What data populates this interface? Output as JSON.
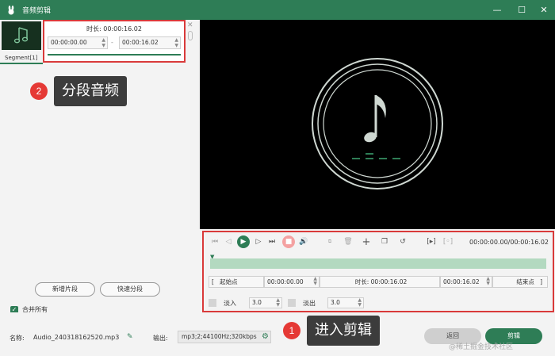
{
  "window": {
    "title": "音频剪辑",
    "logo_icon": "rabbit-icon"
  },
  "controls": {
    "min": "—",
    "max": "☐",
    "close": "✕"
  },
  "segment": {
    "label": "Segment[1]",
    "duration_label": "时长:",
    "duration": "00:00:16.02",
    "start": "00:00:00.00",
    "end": "00:00:16.02",
    "separator": "-"
  },
  "left_buttons": {
    "new_segment": "新增片段",
    "quick_split": "快速分段",
    "merge_all": "合并所有"
  },
  "callouts": {
    "c1_num": "1",
    "c1_text": "进入剪辑",
    "c2_num": "2",
    "c2_text": "分段音频"
  },
  "player": {
    "time_display": "00:00:00.00/00:00:16.02"
  },
  "trim": {
    "start_bracket": "[",
    "start_label": "起始点",
    "start_value": "00:00:00.00",
    "duration_label": "时长:",
    "duration_value": "00:00:16.02",
    "end_value": "00:00:16.02",
    "end_label": "结束点",
    "end_bracket": "]"
  },
  "fade": {
    "fade_in_label": "淡入",
    "fade_in_value": "3.0",
    "fade_out_label": "淡出",
    "fade_out_value": "3.0"
  },
  "bottom": {
    "name_label": "名称:",
    "name_value": "Audio_240318162520.mp3",
    "output_label": "输出:",
    "output_value": "mp3;2;44100Hz;320kbps",
    "back_button": "返回",
    "clip_button": "剪辑",
    "watermark": "@稀土掘金技术社区"
  },
  "colors": {
    "accent": "#2e7d56",
    "highlight": "#d93a3a",
    "callout": "#e53935"
  }
}
